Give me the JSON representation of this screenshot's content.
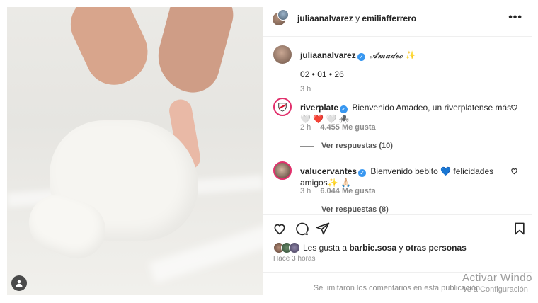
{
  "post": {
    "header": {
      "user1": "juliaanalvarez",
      "joiner": "y",
      "user2": "emiliafferrero",
      "more_icon": "ellipsis-icon"
    },
    "caption": {
      "username": "juliaanalvarez",
      "verified_icon": "verified-icon",
      "text": "𝓐𝓶𝓪𝓭𝓮𝓸",
      "emoji": "✨",
      "date": "02 • 01 • 26",
      "time": "3 h"
    },
    "comments": [
      {
        "username": "riverplate",
        "text": "Bienvenido Amadeo, un riverplatense más 🤍 ❤️ 🤍 🕷️",
        "time": "2 h",
        "likes": "4.455 Me gusta",
        "replies": "Ver respuestas (10)"
      },
      {
        "username": "valucervantes",
        "text": "Bienvenido bebito 💙 felicidades amigos✨ 🙏🏻",
        "time": "3 h",
        "likes": "6.044 Me gusta",
        "replies": "Ver respuestas (8)"
      }
    ],
    "actions": {
      "like_icon": "heart-icon",
      "comment_icon": "comment-icon",
      "share_icon": "send-icon",
      "save_icon": "bookmark-icon"
    },
    "likes_line": {
      "prefix": "Les gusta a",
      "user": "barbie.sosa",
      "joiner": "y",
      "others": "otras personas"
    },
    "posted_ago": "Hace 3 horas",
    "comments_limited": "Se limitaron los comentarios en esta publicación."
  },
  "os_watermark": {
    "line1": "Activar Windo",
    "line2": "Ve a Configuración"
  },
  "colors": {
    "verified": "#3897f0",
    "text": "#262626",
    "secondary": "#8e8e8e",
    "heart_red": "#ed4956"
  }
}
